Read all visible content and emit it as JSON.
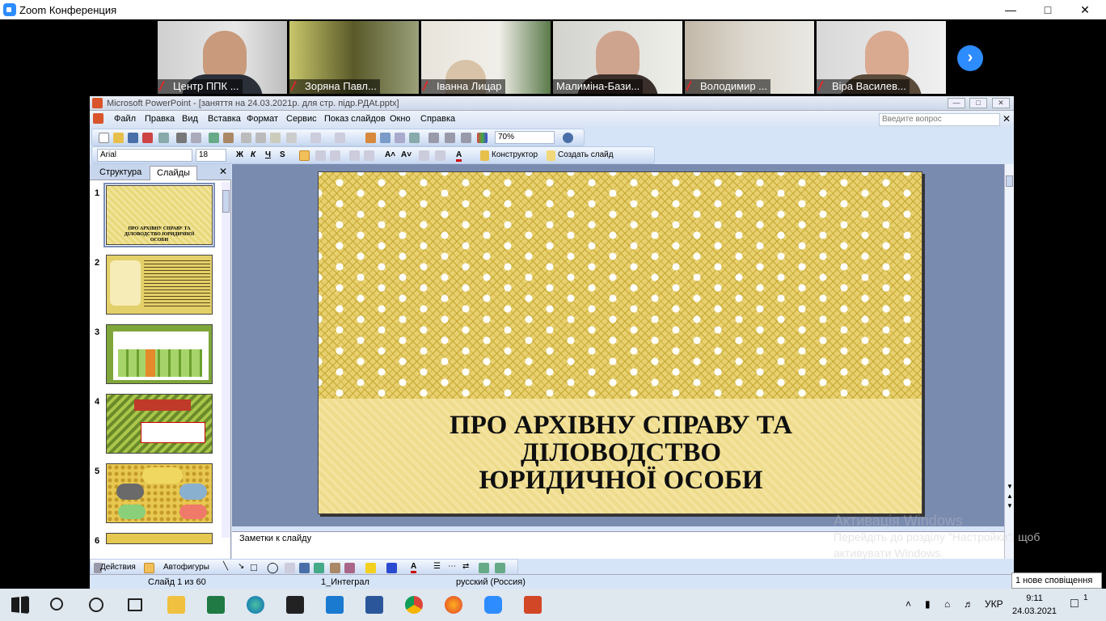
{
  "zoom": {
    "title": "Zoom Конференция",
    "participants": [
      {
        "name": "Центр ППК ...",
        "muted": true
      },
      {
        "name": "Зоряна Павл...",
        "muted": true
      },
      {
        "name": "Іванна Лицар",
        "muted": true
      },
      {
        "name": "Малиміна-Бази...",
        "muted": false
      },
      {
        "name": "Володимир ...",
        "muted": true
      },
      {
        "name": "Віра Василев...",
        "muted": true
      }
    ]
  },
  "ppt": {
    "title": "Microsoft PowerPoint - [заняття на 24.03.2021р. для стр. підр.РДАt.pptx]",
    "menu": [
      "Файл",
      "Правка",
      "Вид",
      "Вставка",
      "Формат",
      "Сервис",
      "Показ слайдов",
      "Окно",
      "Справка"
    ],
    "help_placeholder": "Введите вопрос",
    "zoom_level": "70%",
    "font_name": "Arial",
    "font_size": "18",
    "designer_label": "Конструктор",
    "new_slide_label": "Создать слайд",
    "tabs": {
      "outline": "Структура",
      "slides": "Слайды"
    },
    "thumb1_title": "ПРО АРХІВНУ СПРАВУ ТА ДІЛОВОДСТВО ЮРИДИЧНОЇ ОСОБИ",
    "slide_numbers": [
      "1",
      "2",
      "3",
      "4",
      "5",
      "6"
    ],
    "slide_title_lines": [
      "ПРО АРХІВНУ СПРАВУ ТА",
      "ДІЛОВОДСТВО",
      "ЮРИДИЧНОЇ ОСОБИ"
    ],
    "notes_placeholder": "Заметки к слайду",
    "draw_actions": "Действия",
    "autoshapes": "Автофигуры",
    "status": {
      "slide": "Слайд 1 из 60",
      "design": "1_Интеграл",
      "language": "русский (Россия)"
    }
  },
  "watermark": {
    "line1": "Активація Windows",
    "line2": "Перейдіть до розділу \"Настройки\", щоб",
    "line3": "активувати Windows."
  },
  "notification": "1 нове сповіщення",
  "taskbar": {
    "language": "УКР",
    "time": "9:11",
    "date": "24.03.2021",
    "notification_count": "1"
  }
}
